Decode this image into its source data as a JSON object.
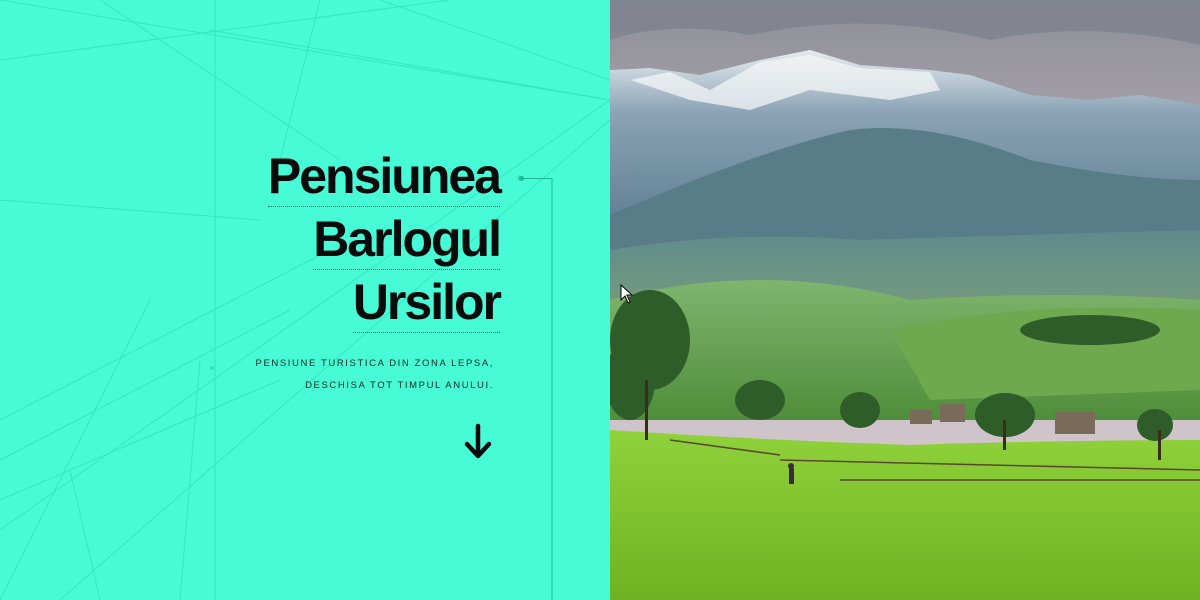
{
  "hero": {
    "title_lines": [
      "Pensiunea",
      "Barlogul",
      "Ursilor"
    ],
    "subtitle_lines": [
      "PENSIUNE TURISTICA DIN ZONA LEPSA,",
      "DESCHISA TOT TIMPUL ANULUI."
    ],
    "scroll_icon": "arrow-down-icon"
  },
  "colors": {
    "panel_background": "#46fbd6",
    "title_text": "#0b0b0b",
    "line_color": "#2ee0bb"
  },
  "photo": {
    "scene": "mountain-landscape-photo"
  }
}
